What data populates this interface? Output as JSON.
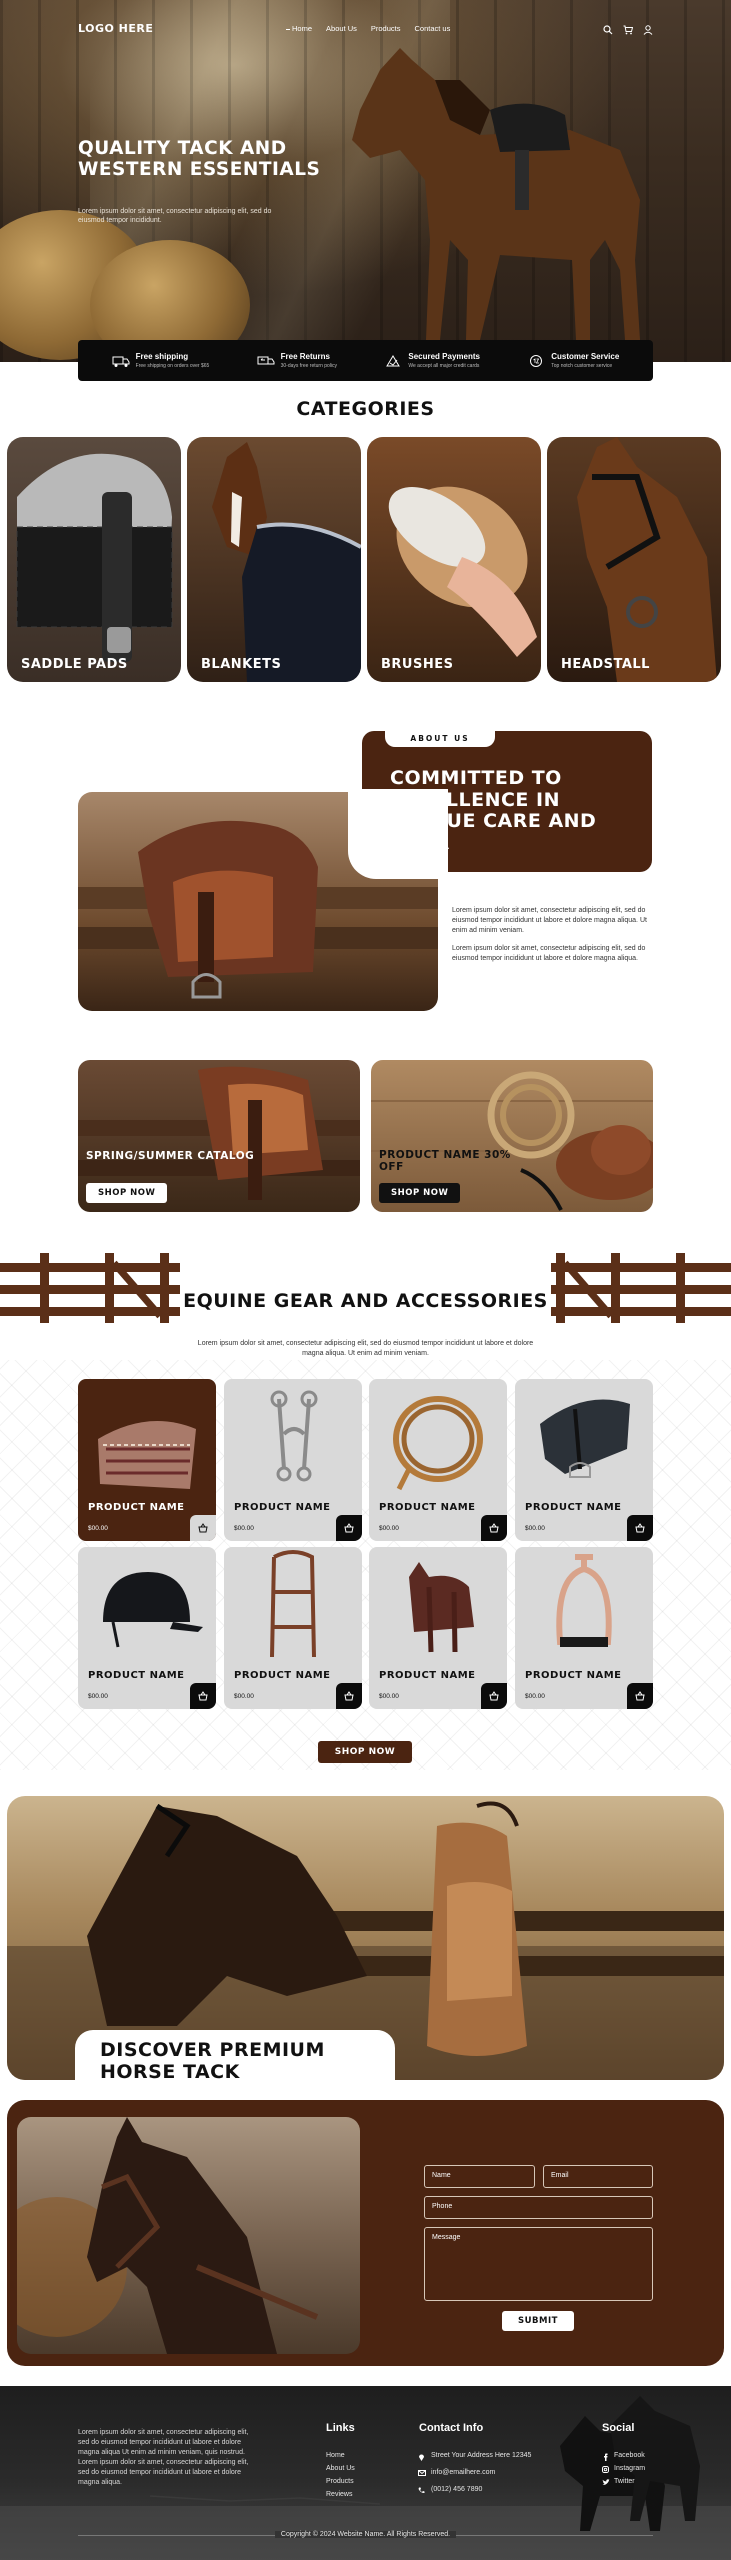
{
  "nav": {
    "logo": "LOGO HERE",
    "links": [
      "Home",
      "About Us",
      "Products",
      "Contact us"
    ],
    "icons": [
      "search-icon",
      "cart-icon",
      "user-icon"
    ]
  },
  "hero": {
    "title": "QUALITY TACK AND WESTERN ESSENTIALS",
    "subtitle": "Lorem ipsum dolor sit amet, consectetur adipiscing elit, sed do eiusmod tempor incididunt."
  },
  "features": [
    {
      "title": "Free shipping",
      "desc": "Free shipping on orders over $65",
      "icon": "truck-icon"
    },
    {
      "title": "Free Returns",
      "desc": "30-days free return policy",
      "icon": "returns-truck-icon"
    },
    {
      "title": "Secured Payments",
      "desc": "We accept all major credit cards",
      "icon": "secure-payment-icon"
    },
    {
      "title": "Customer Service",
      "desc": "Top notch customer service",
      "icon": "support-24-icon"
    }
  ],
  "categories": {
    "title": "CATEGORIES",
    "items": [
      "SADDLE PADS",
      "BLANKETS",
      "BRUSHES",
      "HEADSTALL"
    ]
  },
  "about": {
    "tag": "ABOUT US",
    "title": "COMMITTED TO EXCELLENCE IN UNIQUE CARE AND GEAR",
    "p1": "Lorem ipsum dolor sit amet, consectetur adipiscing elit, sed do eiusmod tempor incididunt ut labore et dolore magna aliqua. Ut enim ad minim veniam.",
    "p2": "Lorem ipsum dolor sit amet, consectetur adipiscing elit, sed do eiusmod tempor incididunt ut labore et dolore magna aliqua."
  },
  "promos": [
    {
      "title": "SPRING/SUMMER CATALOG",
      "button": "SHOP NOW"
    },
    {
      "title": "PRODUCT NAME 30% OFF",
      "button": "SHOP NOW"
    }
  ],
  "products": {
    "title": "EQUINE GEAR AND ACCESSORIES",
    "subtitle": "Lorem ipsum dolor sit amet, consectetur adipiscing elit, sed do eiusmod tempor incididunt ut labore et dolore magna aliqua. Ut enim ad minim veniam.",
    "items": [
      {
        "name": "PRODUCT NAME",
        "price": "$00.00",
        "icon": "saddle-pad-icon"
      },
      {
        "name": "PRODUCT NAME",
        "price": "$00.00",
        "icon": "bit-icon"
      },
      {
        "name": "PRODUCT NAME",
        "price": "$00.00",
        "icon": "rope-icon"
      },
      {
        "name": "PRODUCT NAME",
        "price": "$00.00",
        "icon": "english-saddle-icon"
      },
      {
        "name": "PRODUCT NAME",
        "price": "$00.00",
        "icon": "helmet-icon"
      },
      {
        "name": "PRODUCT NAME",
        "price": "$00.00",
        "icon": "bridle-icon"
      },
      {
        "name": "PRODUCT NAME",
        "price": "$00.00",
        "icon": "western-saddle-icon"
      },
      {
        "name": "PRODUCT NAME",
        "price": "$00.00",
        "icon": "stirrup-icon"
      }
    ],
    "shop_now": "SHOP NOW"
  },
  "banner": {
    "title": "DISCOVER PREMIUM HORSE TACK"
  },
  "contact": {
    "name_placeholder": "Name",
    "email_placeholder": "Email",
    "phone_placeholder": "Phone",
    "message_placeholder": "Message",
    "submit": "SUBMIT"
  },
  "footer": {
    "about": "Lorem ipsum dolor sit amet, consectetur adipiscing elit, sed do eiusmod tempor incididunt ut labore et dolore magna aliqua Ut enim ad minim veniam, quis nostrud. Lorem ipsum dolor sit amet, consectetur adipiscing elit, sed do eiusmod tempor incididunt ut labore et dolore magna aliqua.",
    "links_title": "Links",
    "links": [
      "Home",
      "About Us",
      "Products",
      "Reviews"
    ],
    "contact_title": "Contact Info",
    "address": "Street Your Address Here 12345",
    "email": "info@emailhere.com",
    "phone": "(0012) 456 7890",
    "social_title": "Social",
    "social": [
      "Facebook",
      "Instagram",
      "Twitter"
    ],
    "copyright": "Copyright © 2024 Website Name. All Rights Reserved."
  },
  "colors": {
    "brand_brown": "#4b2411",
    "dark": "#0b0b0b",
    "card_gray": "#d9d9d9"
  }
}
